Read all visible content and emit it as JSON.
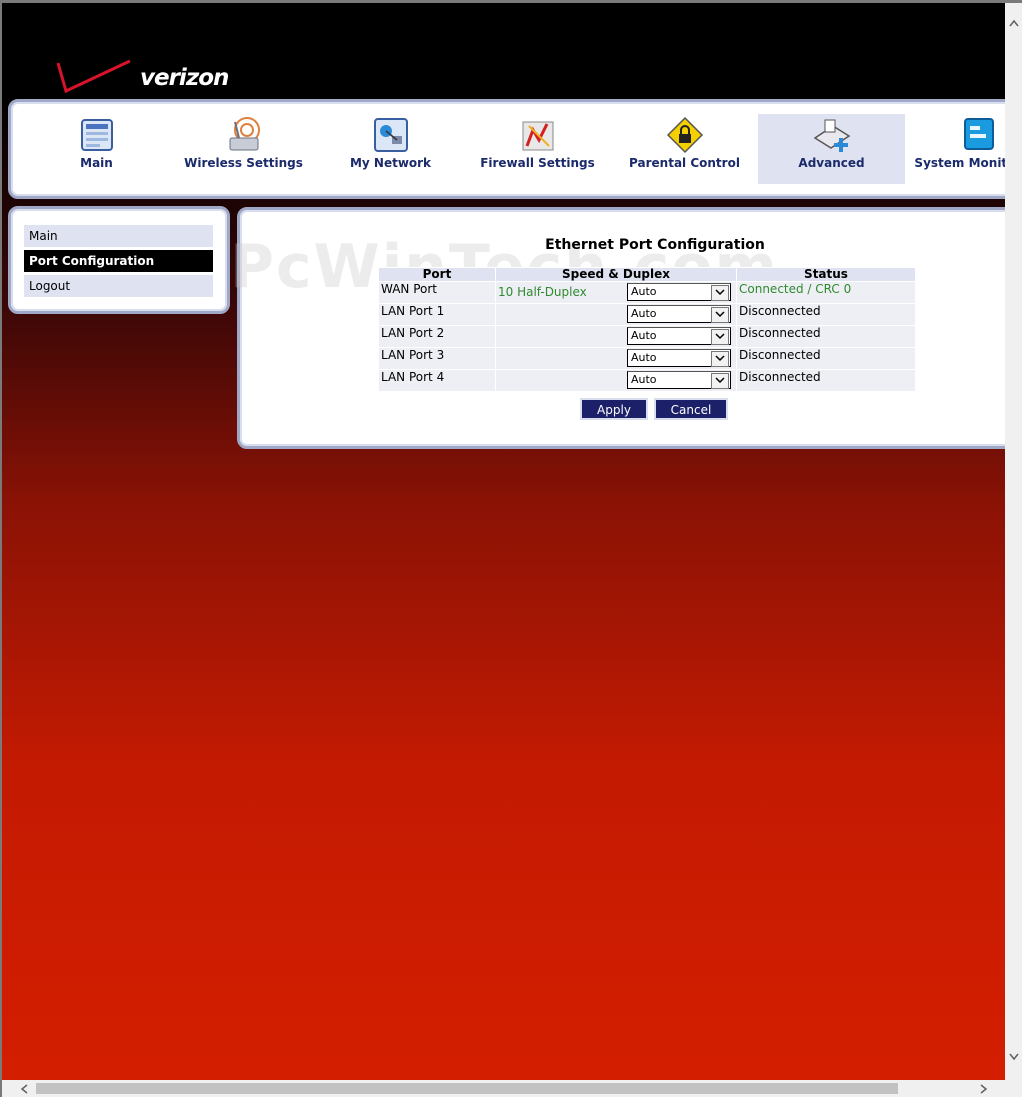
{
  "brand": {
    "logo_text": "verizon"
  },
  "topnav": {
    "items": [
      {
        "label": "Main",
        "icon": "main-icon"
      },
      {
        "label": "Wireless Settings",
        "icon": "wireless-icon"
      },
      {
        "label": "My Network",
        "icon": "network-icon"
      },
      {
        "label": "Firewall Settings",
        "icon": "firewall-icon"
      },
      {
        "label": "Parental Control",
        "icon": "lock-icon"
      },
      {
        "label": "Advanced",
        "icon": "advanced-icon",
        "active": true
      },
      {
        "label": "System Monitoring",
        "icon": "monitor-icon"
      }
    ]
  },
  "sidebar": {
    "items": [
      {
        "label": "Main"
      },
      {
        "label": "Port Configuration",
        "active": true
      },
      {
        "label": "Logout"
      }
    ]
  },
  "watermark": "PcWinTech.com",
  "main": {
    "title": "Ethernet Port Configuration",
    "headers": {
      "port": "Port",
      "speed": "Speed & Duplex",
      "status": "Status"
    },
    "rows": [
      {
        "port": "WAN Port",
        "speed_value": "10 Half-Duplex",
        "select": "Auto",
        "status": "Connected / CRC 0"
      },
      {
        "port": "LAN Port 1",
        "speed_value": "",
        "select": "Auto",
        "status": "Disconnected"
      },
      {
        "port": "LAN Port 2",
        "speed_value": "",
        "select": "Auto",
        "status": "Disconnected"
      },
      {
        "port": "LAN Port 3",
        "speed_value": "",
        "select": "Auto",
        "status": "Disconnected"
      },
      {
        "port": "LAN Port 4",
        "speed_value": "",
        "select": "Auto",
        "status": "Disconnected"
      }
    ],
    "buttons": {
      "apply": "Apply",
      "cancel": "Cancel"
    }
  },
  "colors": {
    "accent": "#1b2068",
    "nav_text": "#1b2a6b",
    "connected": "#2f8a2f",
    "panel_border": "#9fa8c6"
  }
}
